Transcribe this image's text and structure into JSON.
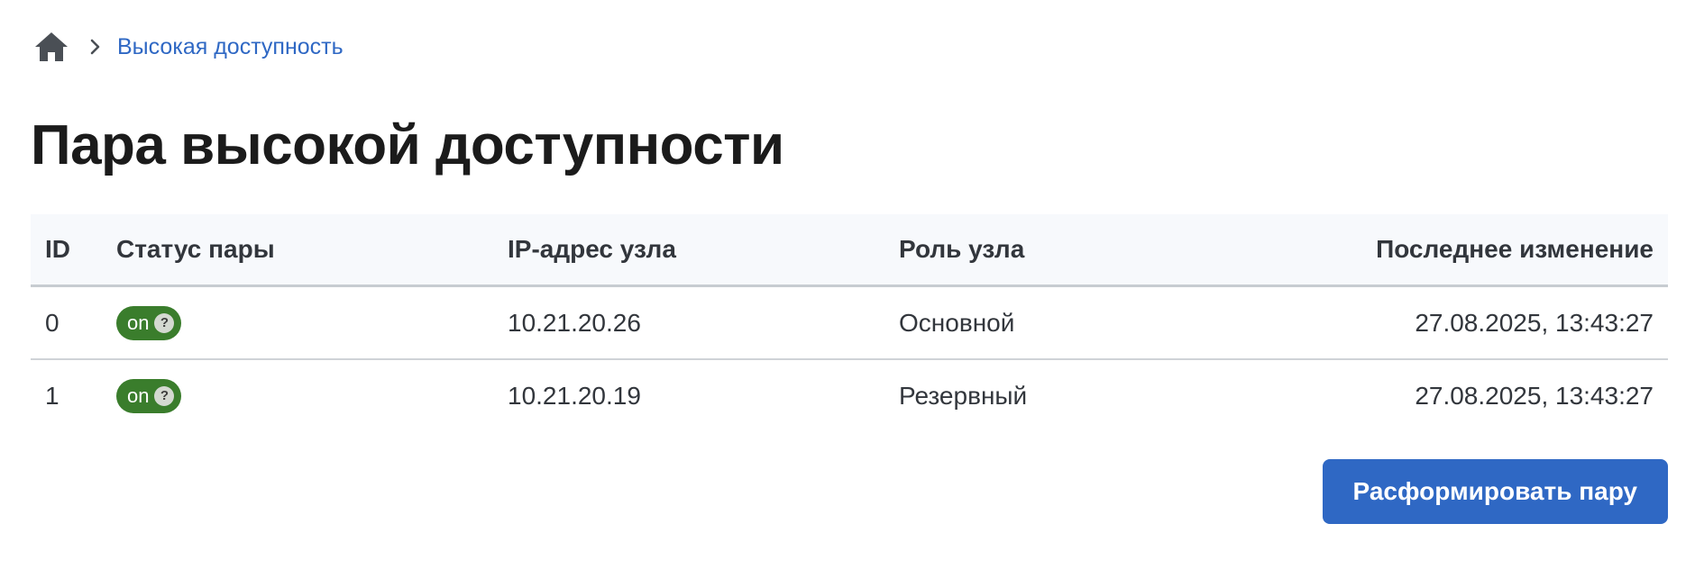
{
  "breadcrumb": {
    "home_icon": "home-icon",
    "separator_icon": "chevron-right-icon",
    "items": [
      {
        "label": "Высокая доступность"
      }
    ]
  },
  "page_title": "Пара высокой доступности",
  "table": {
    "columns": [
      {
        "label": "ID"
      },
      {
        "label": "Статус пары"
      },
      {
        "label": "IP-адрес узла"
      },
      {
        "label": "Роль узла"
      },
      {
        "label": "Последнее изменение"
      }
    ],
    "rows": [
      {
        "id": "0",
        "status": "on",
        "status_help": "?",
        "ip": "10.21.20.26",
        "role": "Основной",
        "changed": "27.08.2025, 13:43:27"
      },
      {
        "id": "1",
        "status": "on",
        "status_help": "?",
        "ip": "10.21.20.19",
        "role": "Резервный",
        "changed": "27.08.2025, 13:43:27"
      }
    ]
  },
  "actions": {
    "dissolve_label": "Расформировать пару"
  },
  "colors": {
    "link": "#2f68c4",
    "primary_button": "#2f68c4",
    "status_on": "#3a7d2c",
    "header_bg": "#f7f9fc"
  }
}
